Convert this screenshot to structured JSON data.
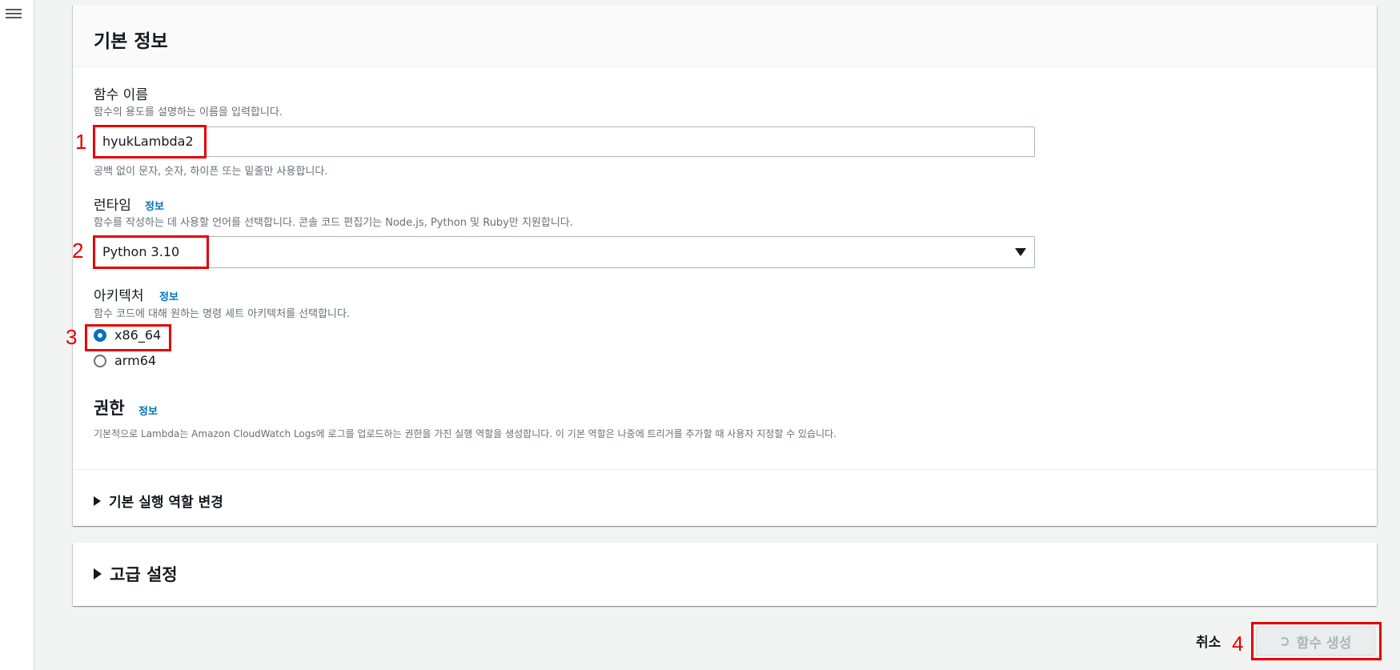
{
  "basic_info": {
    "title": "기본 정보",
    "function_name": {
      "label": "함수 이름",
      "description": "함수의 용도를 설명하는 이름을 입력합니다.",
      "value": "hyukLambda2",
      "hint": "공백 없이 문자, 숫자, 하이픈 또는 밑줄만 사용합니다."
    },
    "runtime": {
      "label": "런타임",
      "info_link": "정보",
      "description": "함수를 작성하는 데 사용할 언어를 선택합니다. 콘솔 코드 편집기는 Node.js, Python 및 Ruby만 지원합니다.",
      "selected": "Python 3.10"
    },
    "architecture": {
      "label": "아키텍처",
      "info_link": "정보",
      "description": "함수 코드에 대해 원하는 명령 세트 아키텍처를 선택합니다.",
      "options": [
        {
          "label": "x86_64",
          "checked": true
        },
        {
          "label": "arm64",
          "checked": false
        }
      ]
    },
    "permissions": {
      "title": "권한",
      "info_link": "정보",
      "description": "기본적으로 Lambda는 Amazon CloudWatch Logs에 로그를 업로드하는 권한을 가진 실행 역할을 생성합니다. 이 기본 역할은 나중에 트리거를 추가할 때 사용자 지정할 수 있습니다.",
      "change_role_label": "기본 실행 역할 변경"
    }
  },
  "advanced_settings": {
    "label": "고급 설정"
  },
  "footer": {
    "cancel_label": "취소",
    "create_label": "함수 생성"
  },
  "annotations": {
    "step1": "1",
    "step2": "2",
    "step3": "3",
    "step4": "4"
  },
  "colors": {
    "accent": "#0073bb",
    "annotation_red": "#e60000"
  }
}
